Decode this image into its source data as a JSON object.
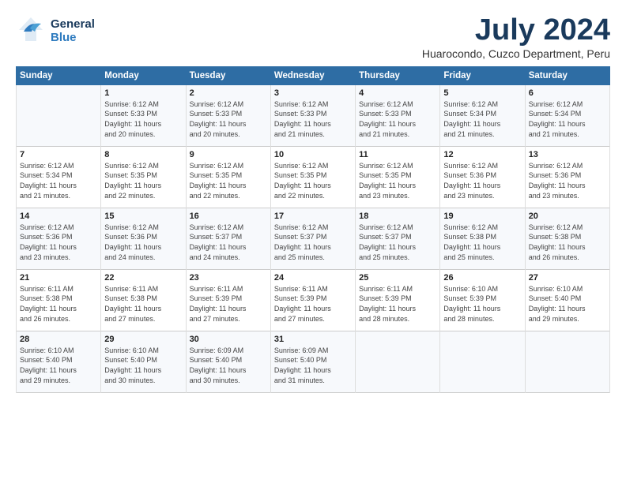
{
  "header": {
    "logo_general": "General",
    "logo_blue": "Blue",
    "title": "July 2024",
    "subtitle": "Huarocondo, Cuzco Department, Peru"
  },
  "days_header": [
    "Sunday",
    "Monday",
    "Tuesday",
    "Wednesday",
    "Thursday",
    "Friday",
    "Saturday"
  ],
  "weeks": [
    [
      {
        "num": "",
        "info": ""
      },
      {
        "num": "1",
        "info": "Sunrise: 6:12 AM\nSunset: 5:33 PM\nDaylight: 11 hours\nand 20 minutes."
      },
      {
        "num": "2",
        "info": "Sunrise: 6:12 AM\nSunset: 5:33 PM\nDaylight: 11 hours\nand 20 minutes."
      },
      {
        "num": "3",
        "info": "Sunrise: 6:12 AM\nSunset: 5:33 PM\nDaylight: 11 hours\nand 21 minutes."
      },
      {
        "num": "4",
        "info": "Sunrise: 6:12 AM\nSunset: 5:33 PM\nDaylight: 11 hours\nand 21 minutes."
      },
      {
        "num": "5",
        "info": "Sunrise: 6:12 AM\nSunset: 5:34 PM\nDaylight: 11 hours\nand 21 minutes."
      },
      {
        "num": "6",
        "info": "Sunrise: 6:12 AM\nSunset: 5:34 PM\nDaylight: 11 hours\nand 21 minutes."
      }
    ],
    [
      {
        "num": "7",
        "info": "Sunrise: 6:12 AM\nSunset: 5:34 PM\nDaylight: 11 hours\nand 21 minutes."
      },
      {
        "num": "8",
        "info": "Sunrise: 6:12 AM\nSunset: 5:35 PM\nDaylight: 11 hours\nand 22 minutes."
      },
      {
        "num": "9",
        "info": "Sunrise: 6:12 AM\nSunset: 5:35 PM\nDaylight: 11 hours\nand 22 minutes."
      },
      {
        "num": "10",
        "info": "Sunrise: 6:12 AM\nSunset: 5:35 PM\nDaylight: 11 hours\nand 22 minutes."
      },
      {
        "num": "11",
        "info": "Sunrise: 6:12 AM\nSunset: 5:35 PM\nDaylight: 11 hours\nand 23 minutes."
      },
      {
        "num": "12",
        "info": "Sunrise: 6:12 AM\nSunset: 5:36 PM\nDaylight: 11 hours\nand 23 minutes."
      },
      {
        "num": "13",
        "info": "Sunrise: 6:12 AM\nSunset: 5:36 PM\nDaylight: 11 hours\nand 23 minutes."
      }
    ],
    [
      {
        "num": "14",
        "info": "Sunrise: 6:12 AM\nSunset: 5:36 PM\nDaylight: 11 hours\nand 23 minutes."
      },
      {
        "num": "15",
        "info": "Sunrise: 6:12 AM\nSunset: 5:36 PM\nDaylight: 11 hours\nand 24 minutes."
      },
      {
        "num": "16",
        "info": "Sunrise: 6:12 AM\nSunset: 5:37 PM\nDaylight: 11 hours\nand 24 minutes."
      },
      {
        "num": "17",
        "info": "Sunrise: 6:12 AM\nSunset: 5:37 PM\nDaylight: 11 hours\nand 25 minutes."
      },
      {
        "num": "18",
        "info": "Sunrise: 6:12 AM\nSunset: 5:37 PM\nDaylight: 11 hours\nand 25 minutes."
      },
      {
        "num": "19",
        "info": "Sunrise: 6:12 AM\nSunset: 5:38 PM\nDaylight: 11 hours\nand 25 minutes."
      },
      {
        "num": "20",
        "info": "Sunrise: 6:12 AM\nSunset: 5:38 PM\nDaylight: 11 hours\nand 26 minutes."
      }
    ],
    [
      {
        "num": "21",
        "info": "Sunrise: 6:11 AM\nSunset: 5:38 PM\nDaylight: 11 hours\nand 26 minutes."
      },
      {
        "num": "22",
        "info": "Sunrise: 6:11 AM\nSunset: 5:38 PM\nDaylight: 11 hours\nand 27 minutes."
      },
      {
        "num": "23",
        "info": "Sunrise: 6:11 AM\nSunset: 5:39 PM\nDaylight: 11 hours\nand 27 minutes."
      },
      {
        "num": "24",
        "info": "Sunrise: 6:11 AM\nSunset: 5:39 PM\nDaylight: 11 hours\nand 27 minutes."
      },
      {
        "num": "25",
        "info": "Sunrise: 6:11 AM\nSunset: 5:39 PM\nDaylight: 11 hours\nand 28 minutes."
      },
      {
        "num": "26",
        "info": "Sunrise: 6:10 AM\nSunset: 5:39 PM\nDaylight: 11 hours\nand 28 minutes."
      },
      {
        "num": "27",
        "info": "Sunrise: 6:10 AM\nSunset: 5:40 PM\nDaylight: 11 hours\nand 29 minutes."
      }
    ],
    [
      {
        "num": "28",
        "info": "Sunrise: 6:10 AM\nSunset: 5:40 PM\nDaylight: 11 hours\nand 29 minutes."
      },
      {
        "num": "29",
        "info": "Sunrise: 6:10 AM\nSunset: 5:40 PM\nDaylight: 11 hours\nand 30 minutes."
      },
      {
        "num": "30",
        "info": "Sunrise: 6:09 AM\nSunset: 5:40 PM\nDaylight: 11 hours\nand 30 minutes."
      },
      {
        "num": "31",
        "info": "Sunrise: 6:09 AM\nSunset: 5:40 PM\nDaylight: 11 hours\nand 31 minutes."
      },
      {
        "num": "",
        "info": ""
      },
      {
        "num": "",
        "info": ""
      },
      {
        "num": "",
        "info": ""
      }
    ]
  ]
}
